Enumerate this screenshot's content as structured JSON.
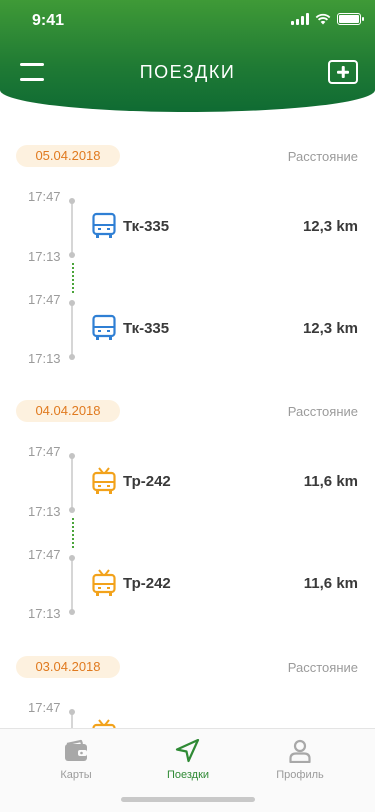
{
  "status": {
    "time": "9:41"
  },
  "header": {
    "title": "ПОЕЗДКИ"
  },
  "colors": {
    "accent": "#2f8a35",
    "bus": "#2f7fd4",
    "trolley": "#f2a21b",
    "date": "#e07a1f"
  },
  "sections": [
    {
      "date": "05.04.2018",
      "distance_label": "Расстояние",
      "trips": [
        {
          "start": "17:47",
          "end": "17:13",
          "icon": "bus-icon",
          "route": "Тк-335",
          "distance": "12,3 km"
        },
        {
          "start": "17:47",
          "end": "17:13",
          "icon": "bus-icon",
          "route": "Тк-335",
          "distance": "12,3 km"
        }
      ]
    },
    {
      "date": "04.04.2018",
      "distance_label": "Расстояние",
      "trips": [
        {
          "start": "17:47",
          "end": "17:13",
          "icon": "trolleybus-icon",
          "route": "Тр-242",
          "distance": "11,6 km"
        },
        {
          "start": "17:47",
          "end": "17:13",
          "icon": "trolleybus-icon",
          "route": "Тр-242",
          "distance": "11,6 km"
        }
      ]
    },
    {
      "date": "03.04.2018",
      "distance_label": "Расстояние",
      "trips": [
        {
          "start": "17:47",
          "icon": "trolleybus-icon"
        }
      ]
    }
  ],
  "tabs": [
    {
      "label": "Карты",
      "icon": "wallet-icon",
      "active": false
    },
    {
      "label": "Поездки",
      "icon": "navigation-arrow-icon",
      "active": true
    },
    {
      "label": "Профиль",
      "icon": "person-icon",
      "active": false
    }
  ]
}
